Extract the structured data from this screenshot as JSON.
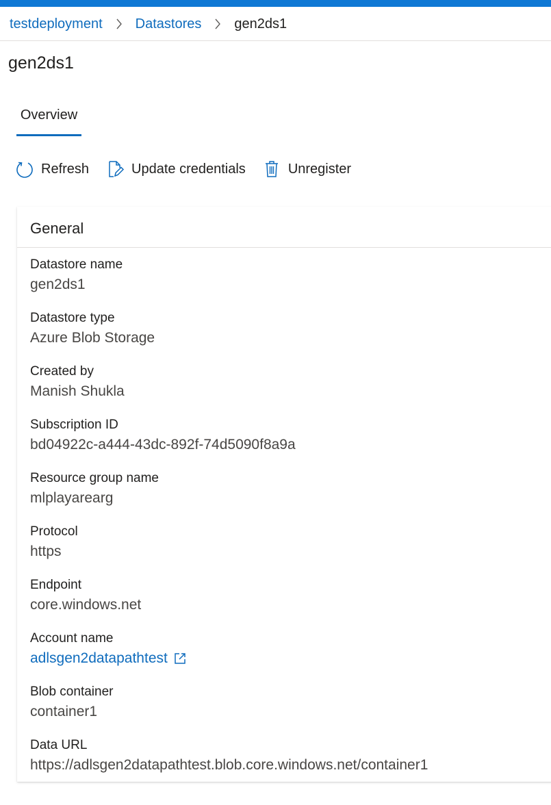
{
  "breadcrumb": {
    "items": [
      {
        "label": "testdeployment"
      },
      {
        "label": "Datastores"
      },
      {
        "label": "gen2ds1"
      }
    ]
  },
  "page": {
    "title": "gen2ds1"
  },
  "tabs": [
    {
      "label": "Overview",
      "selected": true
    }
  ],
  "toolbar": {
    "refresh": {
      "label": "Refresh",
      "icon": "refresh-icon"
    },
    "update_credentials": {
      "label": "Update credentials",
      "icon": "edit-document-icon"
    },
    "unregister": {
      "label": "Unregister",
      "icon": "trash-icon"
    }
  },
  "general": {
    "title": "General",
    "fields": [
      {
        "label": "Datastore name",
        "value": "gen2ds1"
      },
      {
        "label": "Datastore type",
        "value": "Azure Blob Storage"
      },
      {
        "label": "Created by",
        "value": "Manish Shukla"
      },
      {
        "label": "Subscription ID",
        "value": "bd04922c-a444-43dc-892f-74d5090f8a9a"
      },
      {
        "label": "Resource group name",
        "value": "mlplayarearg"
      },
      {
        "label": "Protocol",
        "value": "https"
      },
      {
        "label": "Endpoint",
        "value": "core.windows.net"
      },
      {
        "label": "Account name",
        "value": "adlsgen2datapathtest",
        "link": true,
        "icon": "external-link-icon"
      },
      {
        "label": "Blob container",
        "value": "container1"
      },
      {
        "label": "Data URL",
        "value": "https://adlsgen2datapathtest.blob.core.windows.net/container1"
      }
    ]
  },
  "colors": {
    "accent": "#0f6cbd",
    "top_bar": "#0f78d4",
    "text": "#201f1e",
    "muted_text": "#484644",
    "divider": "#e1dfdd"
  }
}
